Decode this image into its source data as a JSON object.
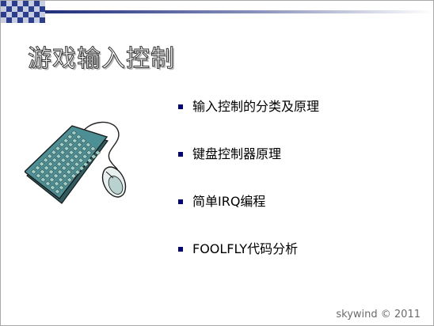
{
  "slide": {
    "title": "游戏输入控制",
    "bullets": [
      {
        "text": "输入控制的分类及原理"
      },
      {
        "text": "键盘控制器原理"
      },
      {
        "text": "简单IRQ编程"
      },
      {
        "text": "FOOLFLY代码分析"
      }
    ],
    "watermark": "skywind © 2011"
  },
  "icons": {
    "clipart": "keyboard-and-mouse-icon",
    "corner": "checkerboard-pattern-icon"
  },
  "colors": {
    "bullet": "#000080",
    "keyboard_body": "#4c8f95",
    "keyboard_keys": "#9fcfc6",
    "checker_dark": "#2b3d8f",
    "checker_light": "#c7ccdf"
  }
}
